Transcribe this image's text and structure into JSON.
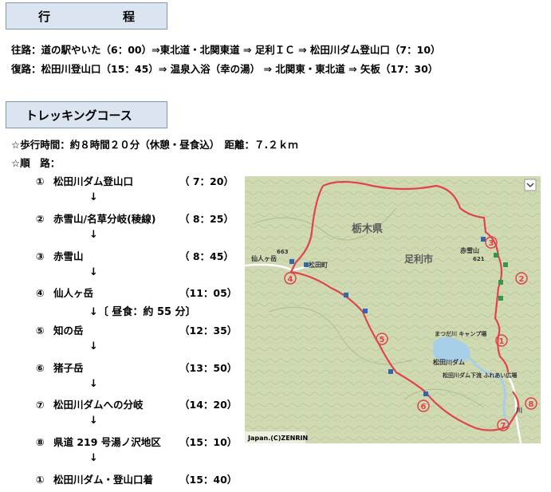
{
  "section1": {
    "title": "行　程"
  },
  "route": {
    "outbound": "往路：道の駅やいた（6：00）⇒東北道・北関東道 ⇒ 足利ＩＣ ⇒ 松田川ダム登山口（7：10）",
    "return": "復路：松田川登山口（15：45）⇒ 温泉入浴（幸の湯） ⇒ 北関東・東北道 ⇒ 矢板（17：30）"
  },
  "section2": {
    "title": "トレッキングコース"
  },
  "summary": "☆歩行時間：約８時間２０分（休憩・昼食込）　距離：７.２ｋｍ",
  "course_label": "☆順　路：",
  "steps": [
    {
      "num": "①",
      "name": "松田川ダム登山口",
      "time": "（ 7：20）"
    },
    {
      "num": "②",
      "name": "赤雪山/名草分岐(稜線)",
      "time": "（ 8：25）"
    },
    {
      "num": "③",
      "name": "赤雪山",
      "time": "（ 8：45）"
    },
    {
      "num": "④",
      "name": "仙人ヶ岳",
      "time": "（11：05）"
    },
    {
      "num": "⑤",
      "name": "知の岳",
      "time": "（12：35）"
    },
    {
      "num": "⑥",
      "name": "猪子岳",
      "time": "（13：50）"
    },
    {
      "num": "⑦",
      "name": "松田川ダムへの分岐",
      "time": "（14：20）"
    },
    {
      "num": "⑧",
      "name": "県道 219 号湯ノ沢地区",
      "time": "（15：10）"
    },
    {
      "num": "①",
      "name": "松田川ダム・登山口着",
      "time": "（15：40）"
    }
  ],
  "arrows": [
    "↓",
    "↓",
    "↓",
    "↓〔 昼食：約 55 分〕",
    "↓",
    "↓",
    "↓",
    "↓"
  ],
  "map": {
    "labels": {
      "prefecture": "栃木県",
      "city": "足利市",
      "akayuki": "赤雪山",
      "akayuki_elev": "621",
      "sennin": "仙人ヶ岳",
      "sennin_elev": "663",
      "town": "松田町",
      "camp": "まつだ川\nキャンプ場",
      "dam": "松田川ダム",
      "park": "松田川ダム下流\nふれあい広場",
      "mizu": "川",
      "copyright": "Japan.(C)ZENRIN"
    },
    "markers": [
      "①",
      "②",
      "③",
      "④",
      "⑤",
      "⑥",
      "⑦",
      "⑧"
    ],
    "colors": {
      "trail": "#e2434b",
      "marker": "#e2434b",
      "terrain": "#cfdab3",
      "water": "#a8cfe8",
      "road": "#ffffff"
    }
  }
}
